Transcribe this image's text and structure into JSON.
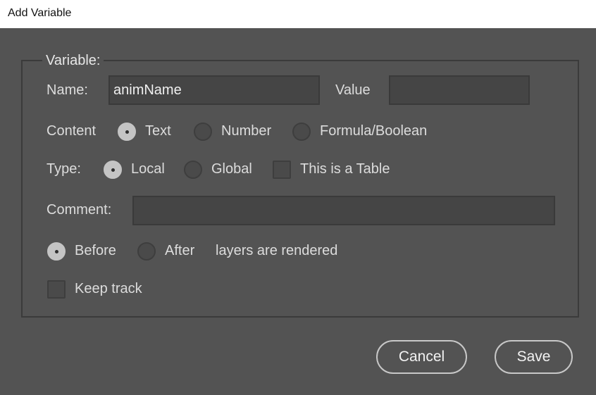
{
  "window": {
    "title": "Add Variable"
  },
  "variable_group": {
    "legend": "Variable:"
  },
  "name": {
    "label": "Name:",
    "value": "animName"
  },
  "value_field": {
    "label": "Value",
    "value": ""
  },
  "content": {
    "label": "Content",
    "options": [
      "Text",
      "Number",
      "Formula/Boolean"
    ],
    "selected": "Text"
  },
  "type": {
    "label": "Type:",
    "options": [
      "Local",
      "Global"
    ],
    "selected": "Local",
    "table_checkbox": {
      "label": "This is a Table",
      "checked": false
    }
  },
  "comment": {
    "label": "Comment:",
    "value": ""
  },
  "render_order": {
    "options": [
      "Before",
      "After"
    ],
    "selected": "Before",
    "suffix": "layers are rendered"
  },
  "keep_track": {
    "label": "Keep track",
    "checked": false
  },
  "buttons": {
    "cancel": "Cancel",
    "save": "Save"
  },
  "colors": {
    "background": "#535353",
    "field_background": "#454545",
    "selected_radio": "#c4c4c4",
    "text": "#dcdcdc"
  }
}
